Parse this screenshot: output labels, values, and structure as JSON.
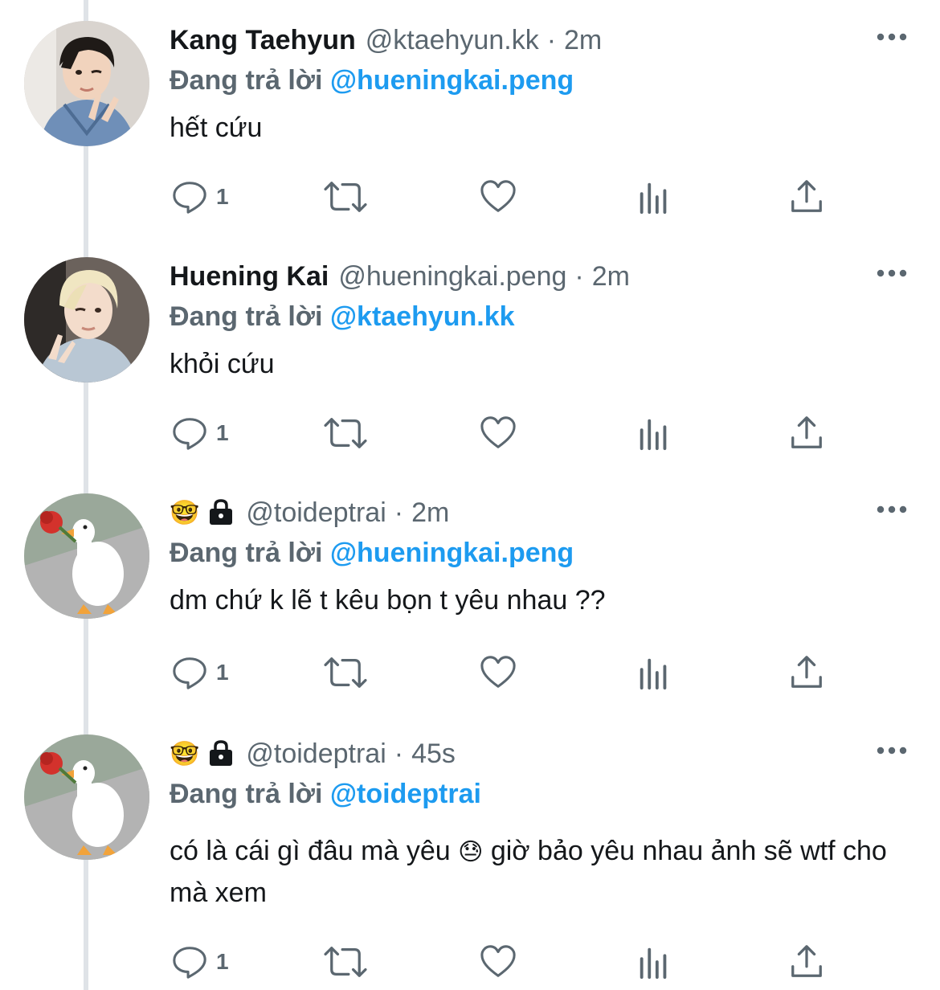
{
  "colors": {
    "link": "#1d9bf0",
    "muted": "#5b6770",
    "text": "#14171a",
    "thread_line": "#dfe3e7"
  },
  "reply_prefix": "Đang trả lời",
  "tweets": [
    {
      "display_name": "Kang Taehyun",
      "handle": "@ktaehyun.kk",
      "separator": "·",
      "time": "2m",
      "reply_to": "@hueningkai.peng",
      "text": "hết cứu",
      "reply_count": "1",
      "avatar_icon": "avatar-photo-boy-denim"
    },
    {
      "display_name": "Huening Kai",
      "handle": "@hueningkai.peng",
      "separator": "·",
      "time": "2m",
      "reply_to": "@ktaehyun.kk",
      "text": "khỏi cứu",
      "reply_count": "1",
      "avatar_icon": "avatar-photo-blond-boy"
    },
    {
      "name_emoji": "🤓",
      "handle": "@toideptrai",
      "separator": "·",
      "time": "2m",
      "reply_to": "@hueningkai.peng",
      "text": "dm chứ k lẽ t kêu bọn t yêu nhau ??",
      "reply_count": "1",
      "avatar_icon": "avatar-goose-with-rose"
    },
    {
      "name_emoji": "🤓",
      "handle": "@toideptrai",
      "separator": "·",
      "time": "45s",
      "reply_to": "@toideptrai",
      "text_part1": "có là cái gì đâu mà yêu",
      "text_emoji": "😓",
      "text_part2": "giờ bảo yêu nhau ảnh sẽ wtf cho mà xem",
      "reply_count": "1",
      "avatar_icon": "avatar-goose-with-rose"
    }
  ]
}
